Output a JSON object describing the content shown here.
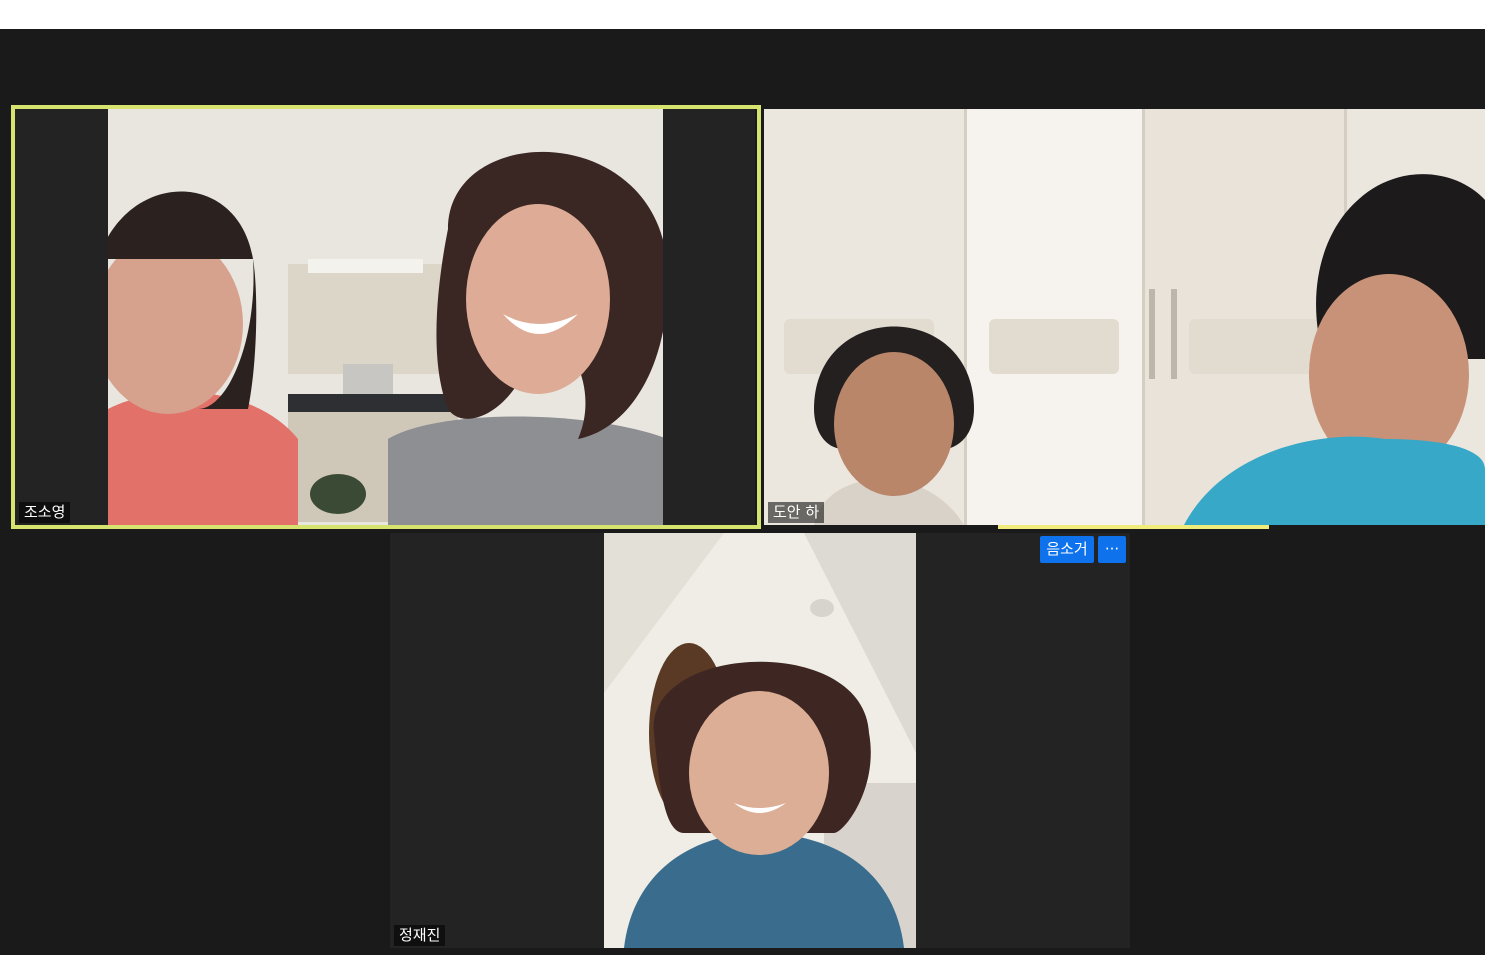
{
  "participants": [
    {
      "name": "조소영",
      "active_speaker": true
    },
    {
      "name": "도안 하",
      "active_speaker": false
    },
    {
      "name": "정재진",
      "active_speaker": false
    }
  ],
  "tile_menu": {
    "mute_label": "음소거",
    "more_label": "···"
  },
  "colors": {
    "active_speaker_border": "#d7e36f",
    "button_blue": "#0e72ed",
    "stage_background": "#1a1a1a"
  }
}
